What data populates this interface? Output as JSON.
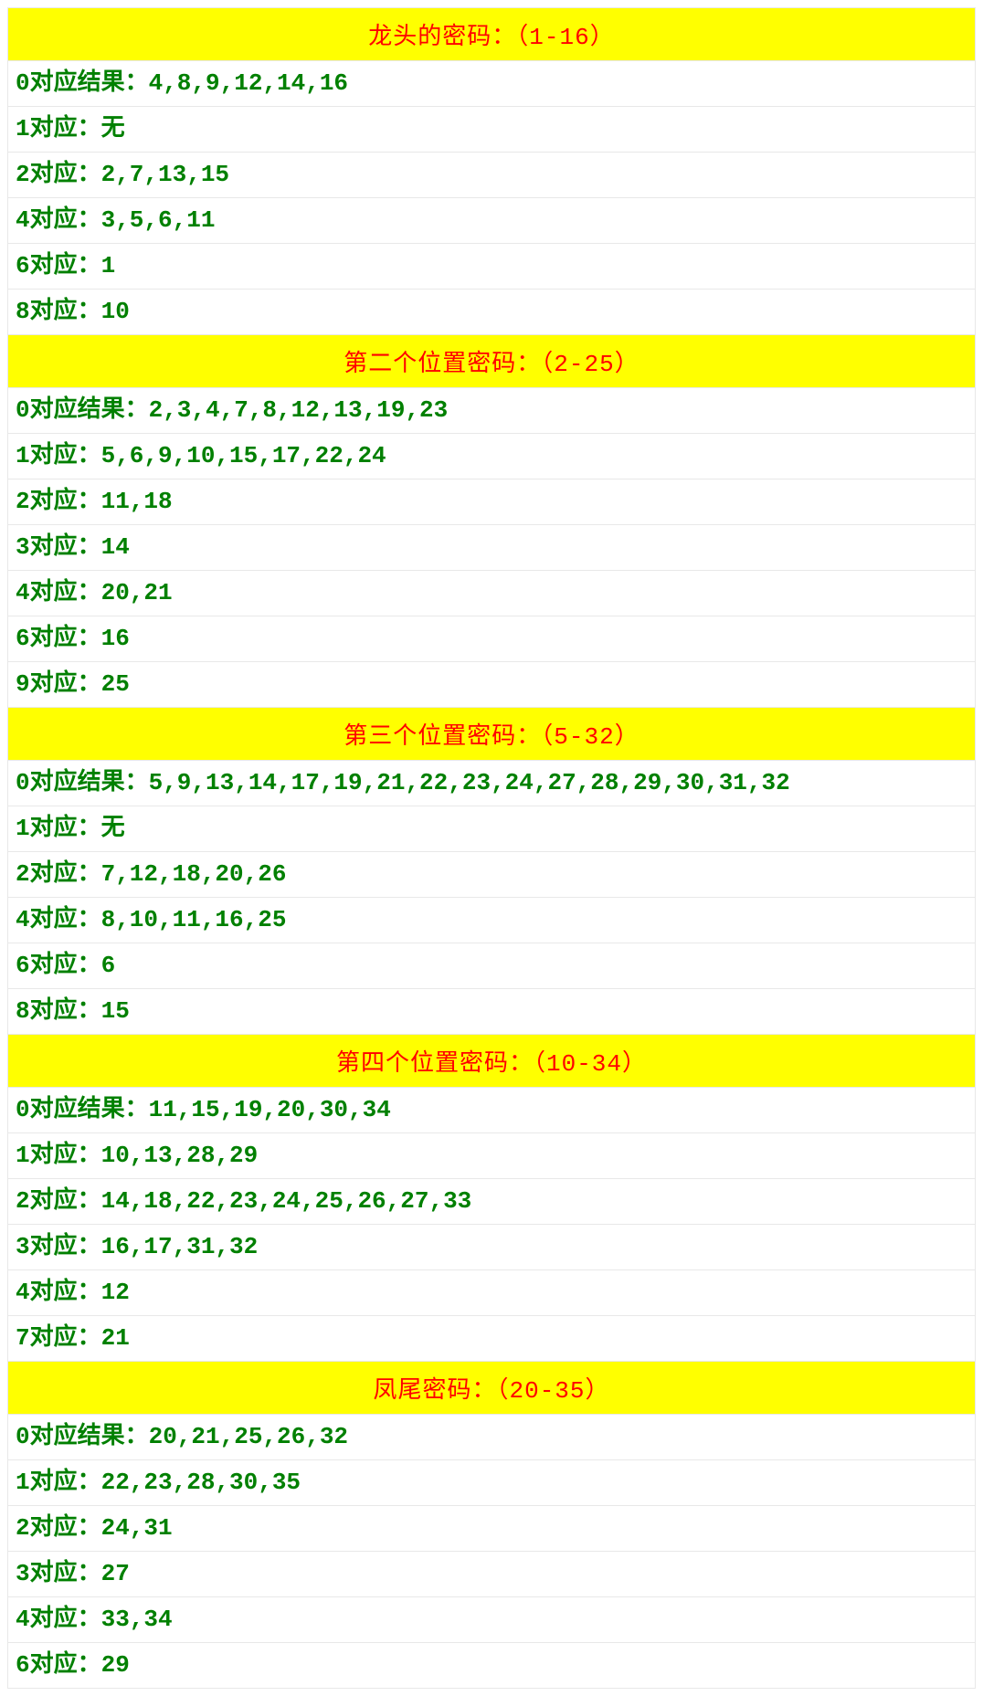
{
  "sections": [
    {
      "title": "龙头的密码：（1-16）",
      "rows": [
        "0对应结果：4,8,9,12,14,16",
        "1对应：无",
        "2对应：2,7,13,15",
        "4对应：3,5,6,11",
        "6对应：1",
        "8对应：10"
      ]
    },
    {
      "title": "第二个位置密码：（2-25）",
      "rows": [
        "0对应结果：2,3,4,7,8,12,13,19,23",
        "1对应：5,6,9,10,15,17,22,24",
        "2对应：11,18",
        "3对应：14",
        "4对应：20,21",
        "6对应：16",
        "9对应：25"
      ]
    },
    {
      "title": "第三个位置密码：（5-32）",
      "rows": [
        "0对应结果：5,9,13,14,17,19,21,22,23,24,27,28,29,30,31,32",
        "1对应：无",
        "2对应：7,12,18,20,26",
        "4对应：8,10,11,16,25",
        "6对应：6",
        "8对应：15"
      ]
    },
    {
      "title": "第四个位置密码：（10-34）",
      "rows": [
        "0对应结果：11,15,19,20,30,34",
        "1对应：10,13,28,29",
        "2对应：14,18,22,23,24,25,26,27,33",
        "3对应：16,17,31,32",
        "4对应：12",
        "7对应：21"
      ]
    },
    {
      "title": "凤尾密码：（20-35）",
      "rows": [
        "0对应结果：20,21,25,26,32",
        "1对应：22,23,28,30,35",
        "2对应：24,31",
        "3对应：27",
        "4对应：33,34",
        "6对应：29"
      ]
    }
  ]
}
